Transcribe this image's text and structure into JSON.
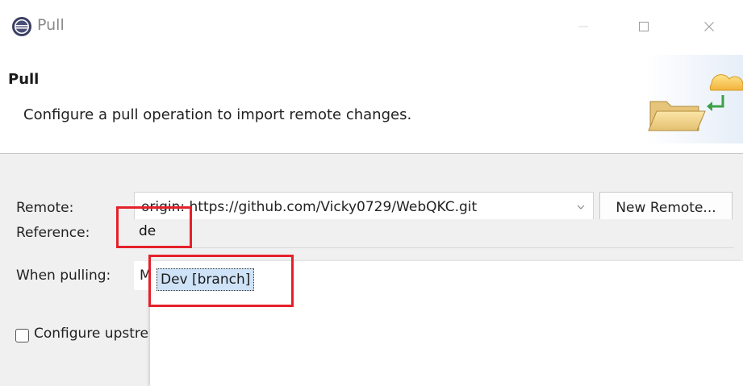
{
  "window": {
    "title": "Pull",
    "minimize_label": "—",
    "maximize_label": "☐",
    "close_label": "✕"
  },
  "banner": {
    "title": "Pull",
    "description": "Configure a pull operation to import remote changes."
  },
  "form": {
    "remote_label": "Remote:",
    "remote_value": "origin: https://github.com/Vicky0729/WebQKC.git",
    "new_remote_button": "New Remote...",
    "reference_label": "Reference:",
    "reference_value": "de",
    "when_pulling_label": "When pulling:",
    "when_pulling_value": "M",
    "configure_upstream_label": "Configure upstream",
    "configure_upstream_checked": false
  },
  "autocomplete": {
    "suggestions": [
      "Dev [branch]"
    ]
  },
  "colors": {
    "highlight_box": "#e5212b",
    "selection": "#cfe3f8",
    "form_background": "#f0f0f0"
  },
  "icons": {
    "app": "eclipse-icon",
    "banner": "folder-cloud-icon",
    "combo": "chevron-down-icon"
  }
}
